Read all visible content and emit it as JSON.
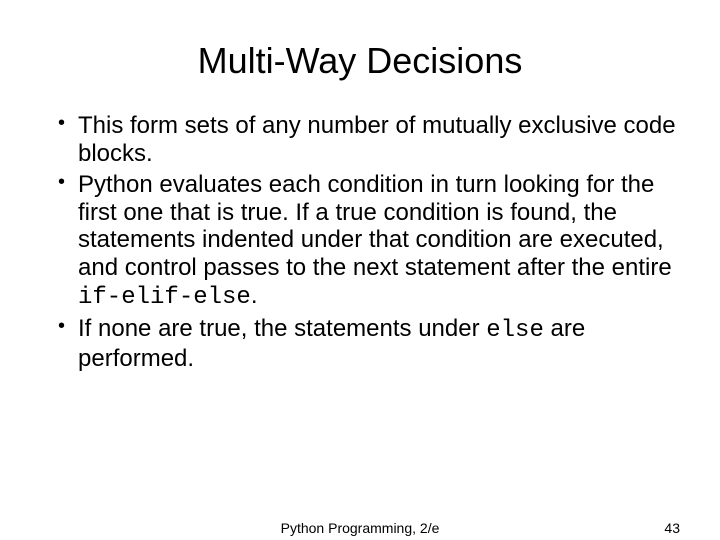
{
  "title": "Multi-Way Decisions",
  "bullets": {
    "b1": "This form sets of any number of mutually exclusive code blocks.",
    "b2a": "Python evaluates each condition in turn looking for the first one that is true. If a true condition is found, the statements indented under that condition are executed, and control passes to the next statement after the entire ",
    "b2code": "if-elif-else",
    "b2b": ".",
    "b3a": "If none are true, the statements under ",
    "b3code": "else",
    "b3b": " are performed."
  },
  "footer": {
    "center": "Python Programming, 2/e",
    "page": "43"
  }
}
